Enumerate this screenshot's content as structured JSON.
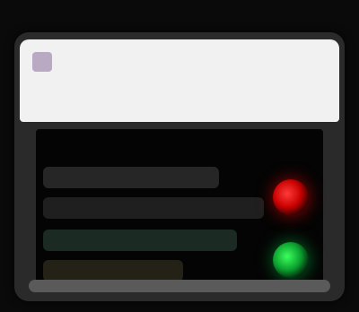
{
  "window": {
    "title": "",
    "icon": "app-icon"
  },
  "panel": {
    "rows": [
      {
        "label": ""
      },
      {
        "label": ""
      },
      {
        "label": ""
      },
      {
        "label": ""
      }
    ],
    "indicators": [
      {
        "name": "red-status-light",
        "color": "#ff1f1f"
      },
      {
        "name": "green-status-light",
        "color": "#1fd24a"
      }
    ]
  },
  "colors": {
    "background": "#0a0a0a",
    "frame": "#2a2a2a",
    "titlebar": "#f1f1f1",
    "panel": "#040404",
    "accent_red": "#ff1f1f",
    "accent_green": "#1fd24a"
  }
}
